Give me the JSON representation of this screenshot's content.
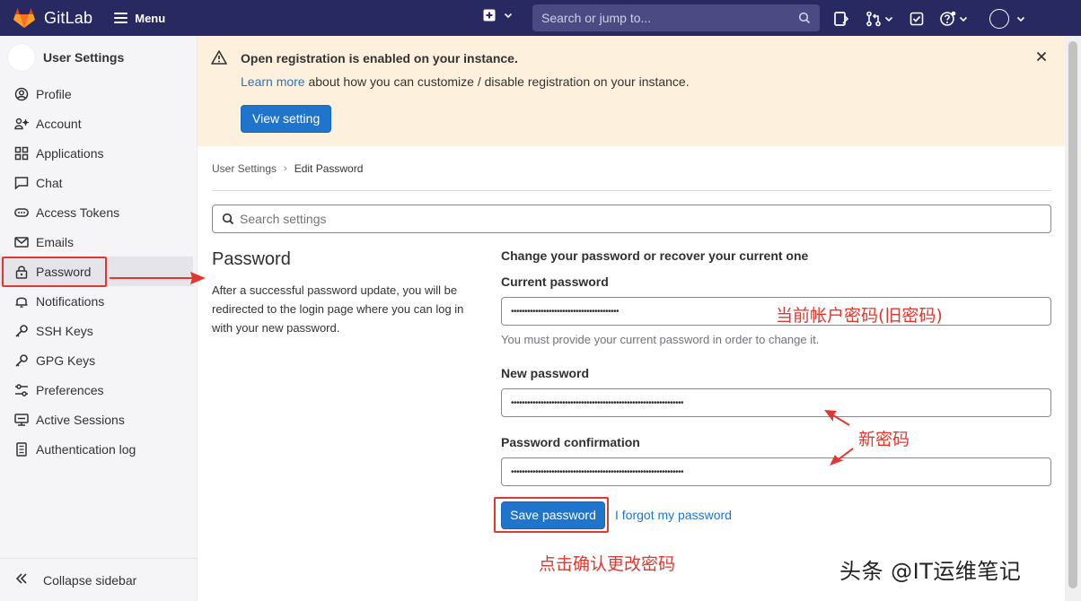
{
  "navbar": {
    "brand": "GitLab",
    "menu_label": "Menu",
    "search_placeholder": "Search or jump to...",
    "icons": [
      "plus-square-icon",
      "chevron-down-icon",
      "search-icon",
      "issues-icon",
      "merge-request-icon",
      "todo-icon",
      "help-icon",
      "avatar"
    ]
  },
  "sidebar": {
    "title": "User Settings",
    "items": [
      {
        "label": "Profile",
        "icon": "profile-icon"
      },
      {
        "label": "Account",
        "icon": "account-icon"
      },
      {
        "label": "Applications",
        "icon": "applications-icon"
      },
      {
        "label": "Chat",
        "icon": "chat-icon"
      },
      {
        "label": "Access Tokens",
        "icon": "token-icon"
      },
      {
        "label": "Emails",
        "icon": "mail-icon"
      },
      {
        "label": "Password",
        "icon": "lock-icon"
      },
      {
        "label": "Notifications",
        "icon": "bell-icon"
      },
      {
        "label": "SSH Keys",
        "icon": "key-icon"
      },
      {
        "label": "GPG Keys",
        "icon": "key-icon"
      },
      {
        "label": "Preferences",
        "icon": "preferences-icon"
      },
      {
        "label": "Active Sessions",
        "icon": "monitor-icon"
      },
      {
        "label": "Authentication log",
        "icon": "log-icon"
      }
    ],
    "active_item": "Password",
    "collapse_label": "Collapse sidebar"
  },
  "banner": {
    "title": "Open registration is enabled on your instance.",
    "link_text": "Learn more",
    "text_rest": " about how you can customize / disable registration on your instance.",
    "button_label": "View setting"
  },
  "breadcrumb": {
    "items": [
      "User Settings",
      "Edit Password"
    ]
  },
  "search_settings": {
    "placeholder": "Search settings"
  },
  "password_section": {
    "heading": "Password",
    "description": "After a successful password update, you will be redirected to the login page where you can log in with your new password.",
    "intro": "Change your password or recover your current one",
    "current_label": "Current password",
    "current_value": "••••••••••••••••••••••••••••••••••••••••",
    "current_help": "You must provide your current password in order to change it.",
    "new_label": "New password",
    "new_value": "••••••••••••••••••••••••••••••••••••••••••••••••••••••••••••••••",
    "confirm_label": "Password confirmation",
    "confirm_value": "••••••••••••••••••••••••••••••••••••••••••••••••••••••••••••••••",
    "save_label": "Save password",
    "forgot_label": "I forgot my password"
  },
  "annotations": {
    "current_pw": "当前帐户密码(旧密码)",
    "new_pw": "新密码",
    "save": "点击确认更改密码"
  },
  "watermark": "头条 @IT运维笔记",
  "colors": {
    "navbar": "#292961",
    "primary": "#1f75cb",
    "banner_bg": "#fdf1dd",
    "annotation_red": "#e3362c"
  }
}
